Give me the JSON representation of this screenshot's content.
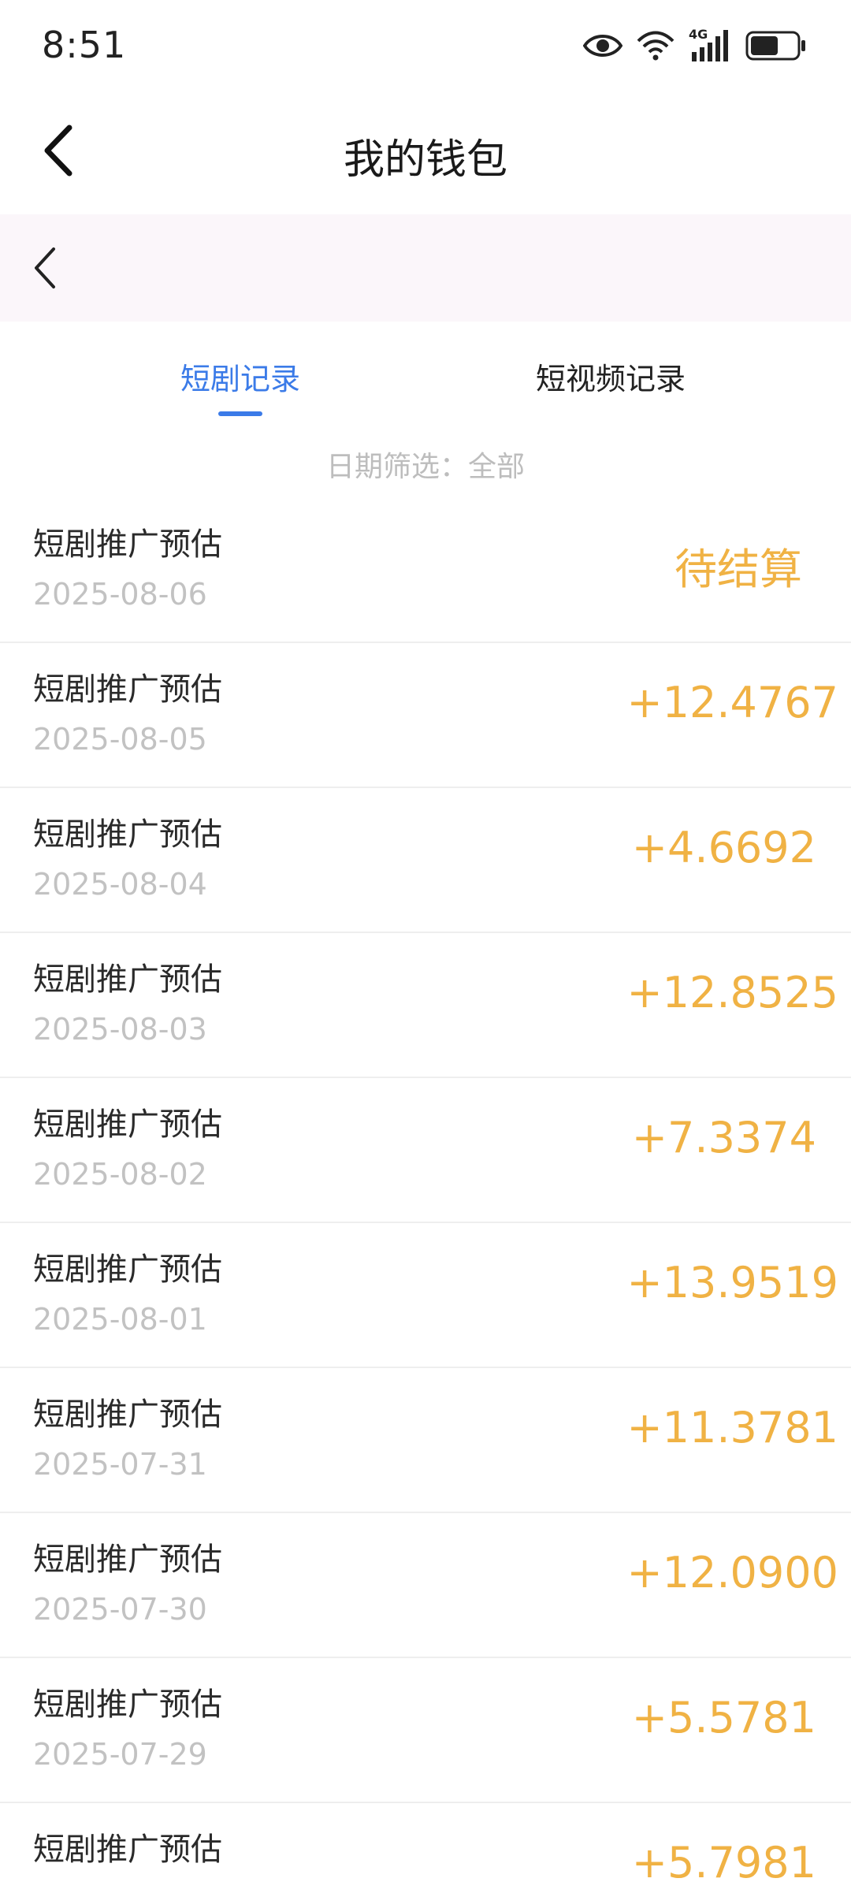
{
  "status_bar": {
    "time": "8:51",
    "icons": [
      "eye-icon",
      "wifi-icon",
      "signal-4g-icon",
      "battery-icon"
    ],
    "network_label": "4G"
  },
  "header": {
    "title": "我的钱包"
  },
  "tabs": [
    {
      "label": "短剧记录",
      "active": true
    },
    {
      "label": "短视频记录",
      "active": false
    }
  ],
  "filter": {
    "text": "日期筛选：全部"
  },
  "records": [
    {
      "title": "短剧推广预估",
      "date": "2025-08-06",
      "amount": "待结算"
    },
    {
      "title": "短剧推广预估",
      "date": "2025-08-05",
      "amount": "+12.4767"
    },
    {
      "title": "短剧推广预估",
      "date": "2025-08-04",
      "amount": "+4.6692"
    },
    {
      "title": "短剧推广预估",
      "date": "2025-08-03",
      "amount": "+12.8525"
    },
    {
      "title": "短剧推广预估",
      "date": "2025-08-02",
      "amount": "+7.3374"
    },
    {
      "title": "短剧推广预估",
      "date": "2025-08-01",
      "amount": "+13.9519"
    },
    {
      "title": "短剧推广预估",
      "date": "2025-07-31",
      "amount": "+11.3781"
    },
    {
      "title": "短剧推广预估",
      "date": "2025-07-30",
      "amount": "+12.0900"
    },
    {
      "title": "短剧推广预估",
      "date": "2025-07-29",
      "amount": "+5.5781"
    },
    {
      "title": "短剧推广预估",
      "date": "",
      "amount": "+5.7981"
    }
  ],
  "colors": {
    "accent": "#3b7be8",
    "amount": "#f0b244",
    "sub_bar_bg": "#fbf6fa"
  }
}
